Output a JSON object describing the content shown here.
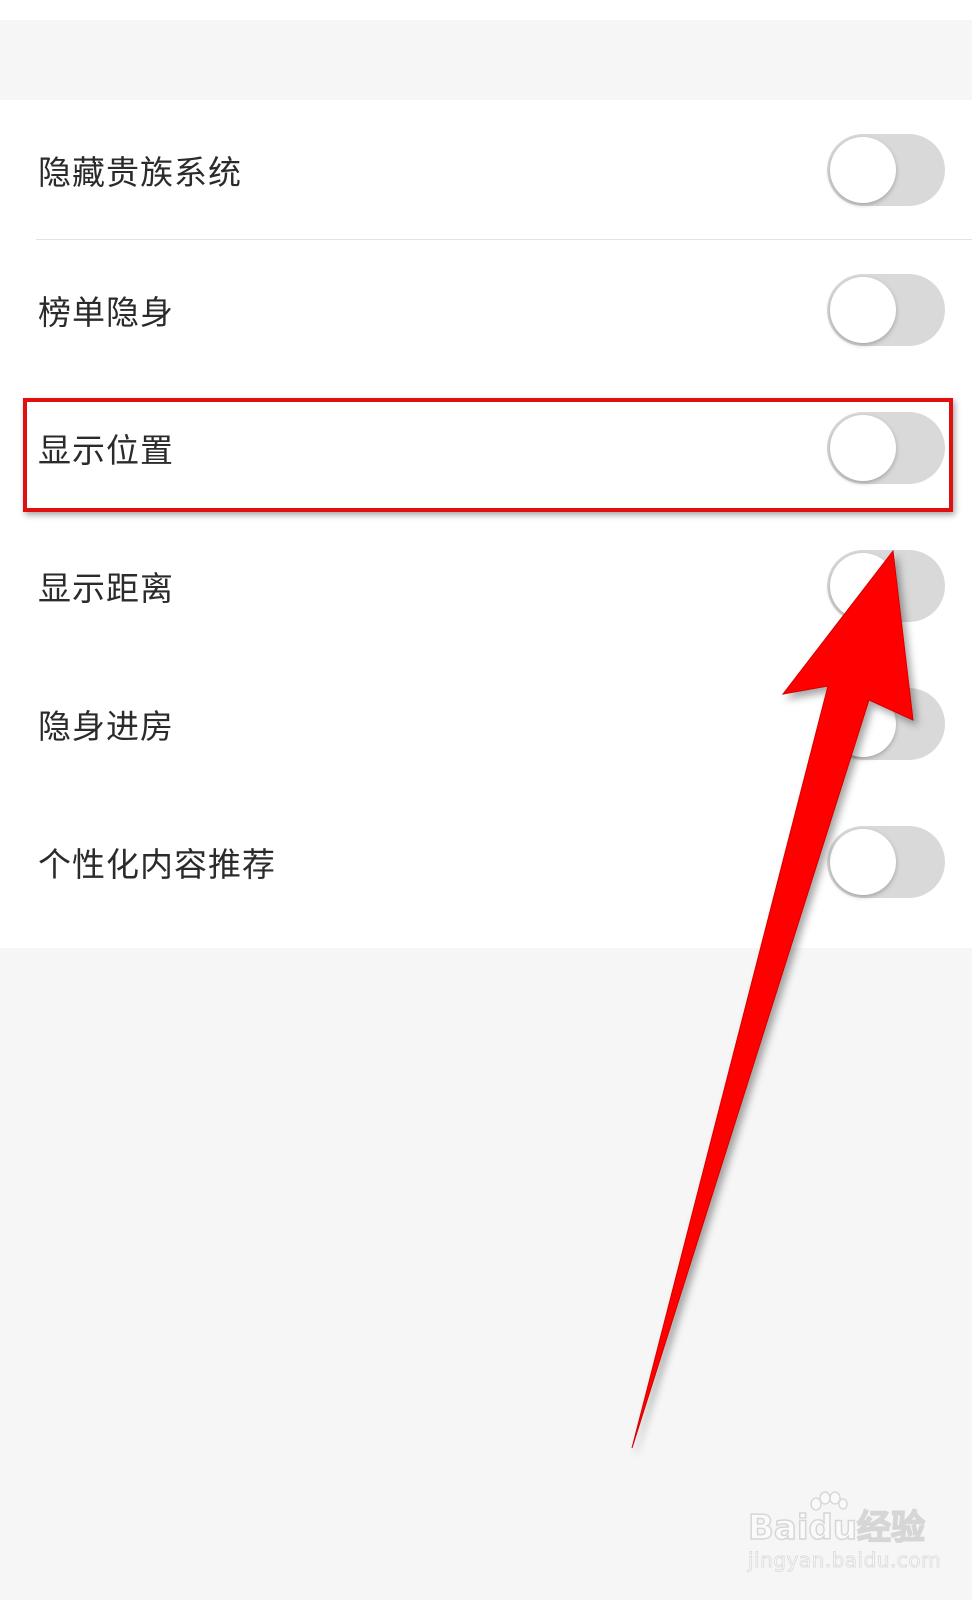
{
  "settings": [
    {
      "label": "隐藏贵族系统",
      "enabled": false
    },
    {
      "label": "榜单隐身",
      "enabled": false
    },
    {
      "label": "显示位置",
      "enabled": false,
      "highlighted": true
    },
    {
      "label": "显示距离",
      "enabled": false
    },
    {
      "label": "隐身进房",
      "enabled": false
    },
    {
      "label": "个性化内容推荐",
      "enabled": false
    }
  ],
  "colors": {
    "page_background": "#f6f6f6",
    "list_background": "#ffffff",
    "toggle_off": "#d9d9d9",
    "annotation_red": "#e01010"
  },
  "watermark": {
    "logo": "Baidu经验",
    "url": "jingyan.baidu.com"
  }
}
